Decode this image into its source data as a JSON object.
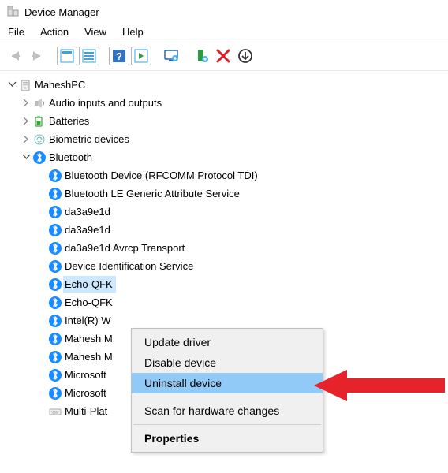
{
  "window": {
    "title": "Device Manager"
  },
  "menubar": {
    "items": [
      "File",
      "Action",
      "View",
      "Help"
    ]
  },
  "tree": {
    "root": {
      "label": "MaheshPC",
      "expanded": true
    },
    "audio": {
      "label": "Audio inputs and outputs"
    },
    "batteries": {
      "label": "Batteries"
    },
    "biometric": {
      "label": "Biometric devices"
    },
    "bluetooth": {
      "label": "Bluetooth",
      "children": [
        "Bluetooth Device (RFCOMM Protocol TDI)",
        "Bluetooth LE Generic Attribute Service",
        "da3a9e1d",
        "da3a9e1d",
        "da3a9e1d Avrcp Transport",
        "Device Identification Service",
        "Echo-QFK",
        "Echo-QFK",
        "Intel(R) W",
        "Mahesh M",
        "Mahesh M",
        "Microsoft",
        "Microsoft",
        "Multi-Plat"
      ],
      "selected_index": 6
    }
  },
  "context_menu": {
    "items": [
      {
        "label": "Update driver"
      },
      {
        "label": "Disable device"
      },
      {
        "label": "Uninstall device",
        "hover": true
      },
      {
        "sep": true
      },
      {
        "label": "Scan for hardware changes"
      },
      {
        "sep": true
      },
      {
        "label": "Properties",
        "bold": true
      }
    ]
  }
}
